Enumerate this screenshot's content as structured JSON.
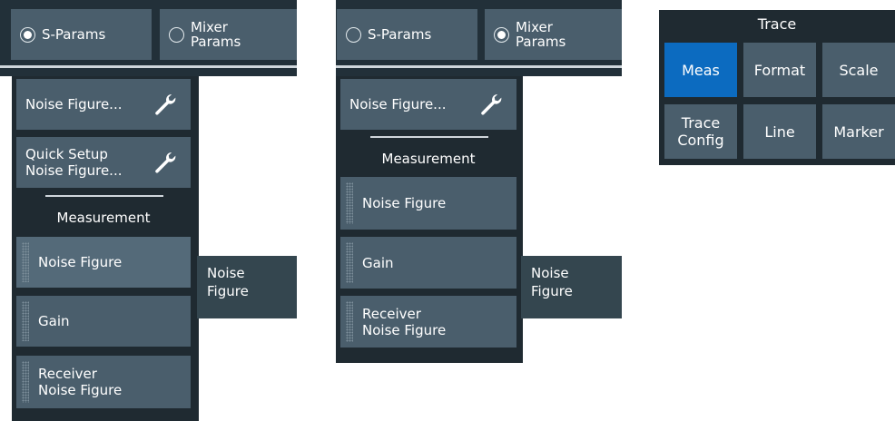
{
  "left": {
    "radio_sparams": "S-Params",
    "radio_mixer_line1": "Mixer",
    "radio_mixer_line2": "Params",
    "noise_figure_btn": "Noise Figure...",
    "quick_setup_line1": "Quick Setup",
    "quick_setup_line2": "Noise Figure...",
    "measurement_heading": "Measurement",
    "items": [
      "Noise Figure",
      "Gain"
    ],
    "receiver_line1": "Receiver",
    "receiver_line2": "Noise Figure",
    "flyout_line1": "Noise",
    "flyout_line2": "Figure",
    "selected_radio": "S-Params"
  },
  "middle": {
    "radio_sparams": "S-Params",
    "radio_mixer_line1": "Mixer",
    "radio_mixer_line2": "Params",
    "noise_figure_btn": "Noise Figure...",
    "measurement_heading": "Measurement",
    "items": [
      "Noise Figure",
      "Gain"
    ],
    "receiver_line1": "Receiver",
    "receiver_line2": "Noise Figure",
    "flyout_line1": "Noise",
    "flyout_line2": "Figure",
    "selected_radio": "Mixer Params"
  },
  "trace": {
    "title": "Trace",
    "buttons": [
      "Meas",
      "Format",
      "Scale",
      "Line",
      "Marker"
    ],
    "trace_config_line1": "Trace",
    "trace_config_line2": "Config",
    "active": "Meas"
  },
  "colors": {
    "button": "#4a5e6c",
    "panel": "#1f2a31",
    "active": "#0c6bc0"
  },
  "icons": [
    "wrench-icon",
    "radio-selected-icon",
    "radio-unselected-icon",
    "grip-icon"
  ]
}
